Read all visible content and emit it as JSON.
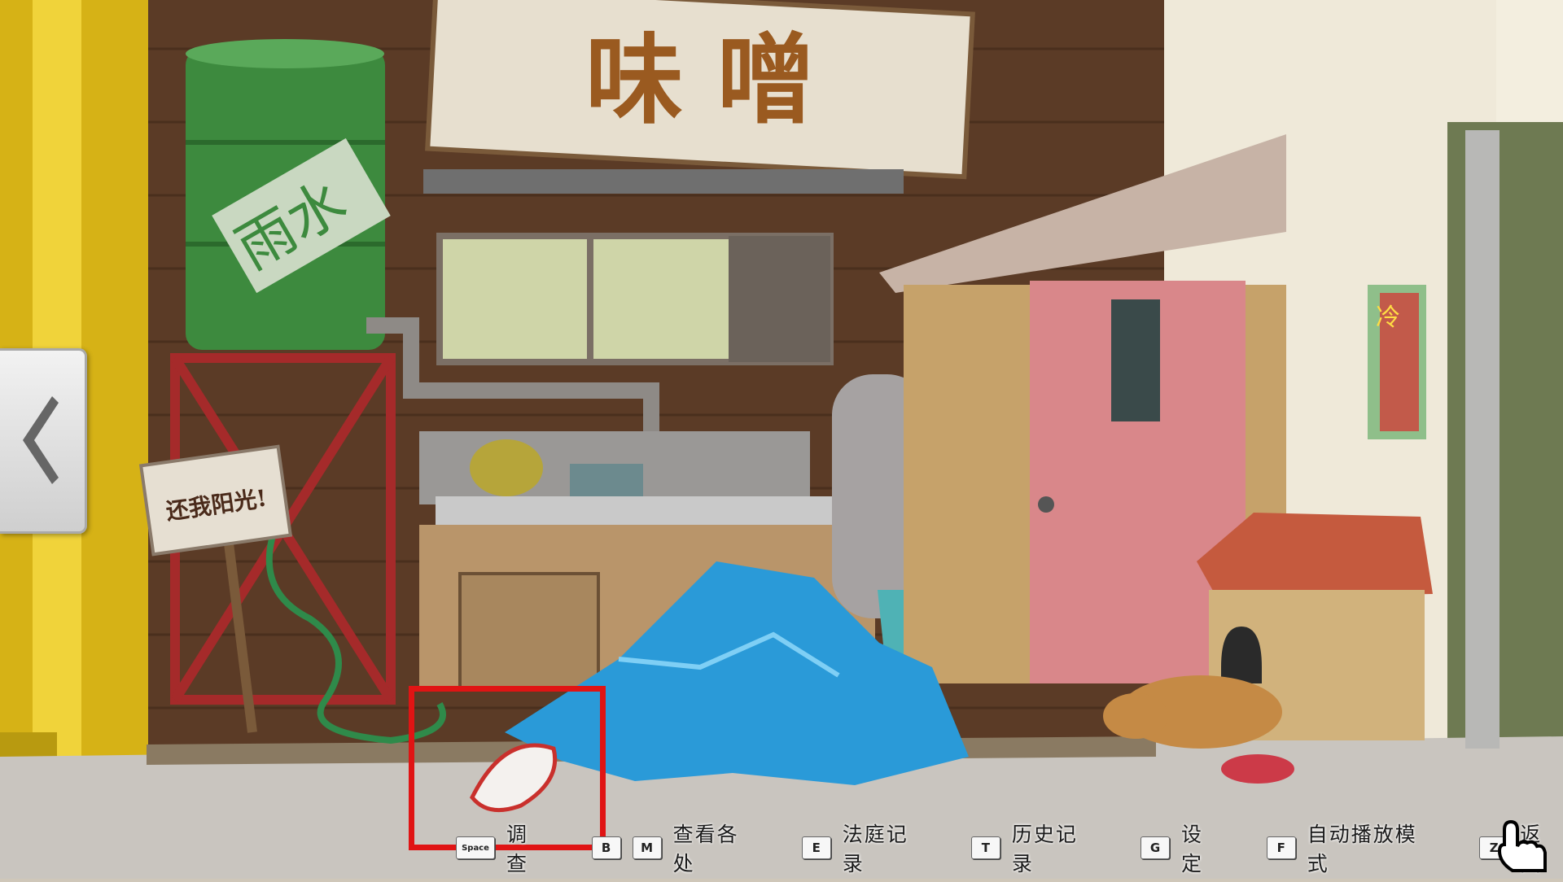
{
  "scene": {
    "shop_sign": "味 噌",
    "barrel_label": "雨水",
    "protest_sign": "还我阳光!",
    "poster_text": "冷"
  },
  "nav": {
    "back_icon": "chevron-left-icon"
  },
  "controls": [
    {
      "key": "Space",
      "label": "调查"
    },
    {
      "key": "B",
      "label": ""
    },
    {
      "key": "M",
      "label": "查看各处"
    },
    {
      "key": "E",
      "label": "法庭记录"
    },
    {
      "key": "T",
      "label": "历史记录"
    },
    {
      "key": "G",
      "label": "设定"
    },
    {
      "key": "F",
      "label": "自动播放模式"
    },
    {
      "key": "Z",
      "label": "返回"
    }
  ],
  "colors": {
    "selection": "#e01414",
    "tarp": "#2a9ad8",
    "door": "#d9878a",
    "barrel": "#3d8a3e"
  }
}
